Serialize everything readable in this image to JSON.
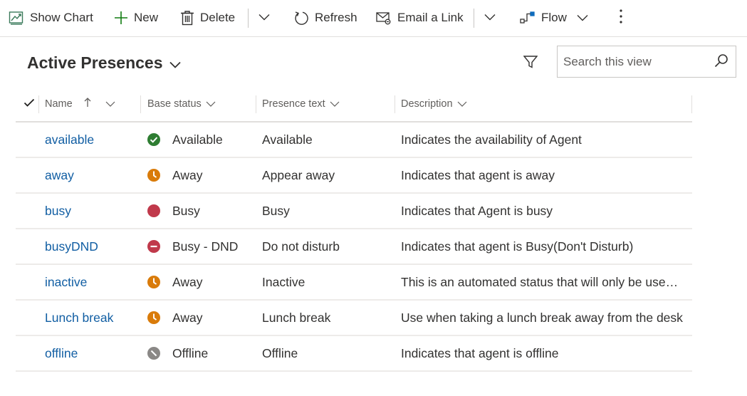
{
  "toolbar": {
    "show_chart": "Show Chart",
    "new": "New",
    "delete": "Delete",
    "refresh": "Refresh",
    "email_link": "Email a Link",
    "flow": "Flow"
  },
  "view": {
    "title": "Active Presences"
  },
  "search": {
    "placeholder": "Search this view"
  },
  "columns": {
    "name": "Name",
    "base_status": "Base status",
    "presence_text": "Presence text",
    "description": "Description"
  },
  "status_colors": {
    "available": "#2e7d32",
    "away": "#d97b0a",
    "busy": "#c0394b",
    "dnd": "#c0394b",
    "offline": "#8a8886"
  },
  "rows": [
    {
      "name": "available",
      "status_icon": "available-icon",
      "base_status": "Available",
      "presence_text": "Available",
      "description": "Indicates the availability of Agent"
    },
    {
      "name": "away",
      "status_icon": "away-clock-icon",
      "base_status": "Away",
      "presence_text": "Appear away",
      "description": "Indicates that agent is away"
    },
    {
      "name": "busy",
      "status_icon": "busy-icon",
      "base_status": "Busy",
      "presence_text": "Busy",
      "description": "Indicates that Agent is busy"
    },
    {
      "name": "busyDND",
      "status_icon": "do-not-disturb-icon",
      "base_status": "Busy - DND",
      "presence_text": "Do not disturb",
      "description": "Indicates that agent is Busy(Don't Disturb)"
    },
    {
      "name": "inactive",
      "status_icon": "away-clock-icon",
      "base_status": "Away",
      "presence_text": "Inactive",
      "description": "This is an automated status that will only be used when the agent is inactive"
    },
    {
      "name": "Lunch break",
      "status_icon": "away-clock-icon",
      "base_status": "Away",
      "presence_text": "Lunch break",
      "description": "Use when taking a lunch break away from the desk"
    },
    {
      "name": "offline",
      "status_icon": "offline-icon",
      "base_status": "Offline",
      "presence_text": "Offline",
      "description": "Indicates that agent is offline"
    }
  ]
}
